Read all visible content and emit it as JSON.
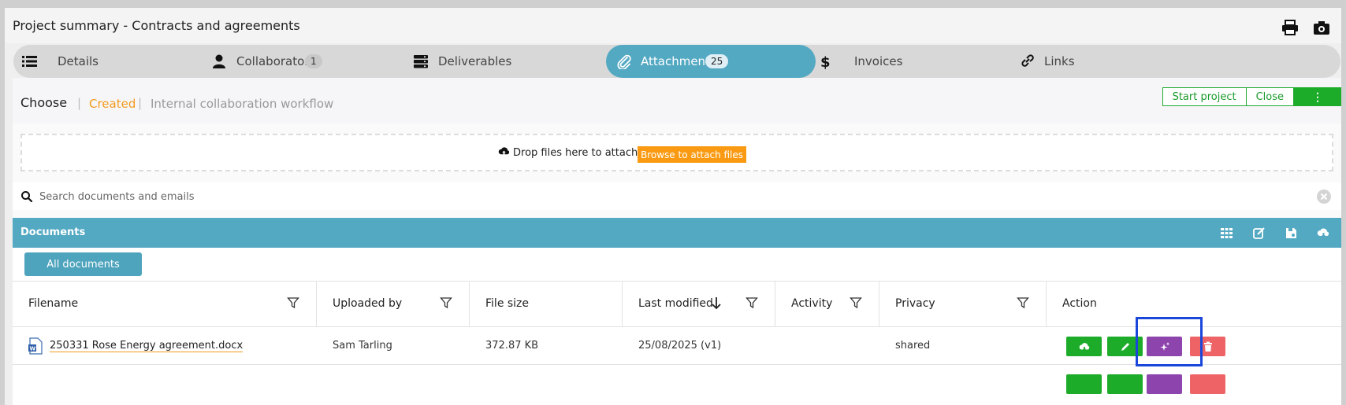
{
  "window": {
    "title": "Project summary - Contracts and agreements"
  },
  "title_icons": [
    "print-icon",
    "camera-icon"
  ],
  "tabs": [
    {
      "label": "Details",
      "icon": "list-icon",
      "badge": ""
    },
    {
      "label": "Collaborators",
      "icon": "user-icon",
      "badge": "1"
    },
    {
      "label": "Deliverables",
      "icon": "server-icon",
      "badge": ""
    },
    {
      "label": "Attachments",
      "icon": "paperclip-icon",
      "badge": "25",
      "active": true
    },
    {
      "label": "Invoices",
      "icon": "dollar-icon",
      "badge": ""
    },
    {
      "label": "Links",
      "icon": "link-icon",
      "badge": ""
    }
  ],
  "status": {
    "choose": "Choose",
    "sep": "|",
    "created": "Created",
    "workflow": "Internal collaboration workflow"
  },
  "actions": {
    "start": "Start project",
    "close": "Close",
    "more": "⋮"
  },
  "dropzone": {
    "text": "Drop files here to attach, or",
    "browse": "Browse to attach files"
  },
  "search": {
    "placeholder": "Search documents and emails"
  },
  "documents": {
    "title": "Documents",
    "all_button": "All documents",
    "columns": [
      "Filename",
      "Uploaded by",
      "File size",
      "Last modified",
      "Activity",
      "Privacy",
      "Action"
    ],
    "rows": [
      {
        "filename": "250331 Rose Energy agreement.docx",
        "file_icon": "word-file-icon",
        "uploaded_by": "Sam Tarling",
        "size": "372.87 KB",
        "modified": "25/08/2025 (v1)",
        "activity": "",
        "privacy": "shared"
      }
    ]
  },
  "colors": {
    "accent": "#53a8c2",
    "orange": "#f99a12",
    "green": "#1dab2a",
    "purple": "#8e44ad",
    "red": "#ee6466",
    "highlight": "#1a47d9"
  }
}
